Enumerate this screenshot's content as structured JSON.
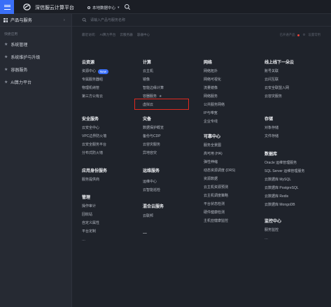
{
  "topbar": {
    "brand": "深信服云计算平台",
    "region": "本地数据中心",
    "region_caret": "▾"
  },
  "sidebar": {
    "header": "产品与服务",
    "chevron": "›",
    "sub_label": "快捷应用",
    "items": [
      {
        "label": "系统管理"
      },
      {
        "label": "系统维护与升级"
      },
      {
        "label": "容器服务"
      },
      {
        "label": "AI算力平台"
      }
    ]
  },
  "main": {
    "search_placeholder": "请输入产品与服务名称",
    "quick_links": [
      "最近访问:",
      "AI算力平台",
      "云服务器",
      "容器中心"
    ],
    "quick_right": [
      "已开通产品",
      "设置常用"
    ],
    "columns": [
      {
        "sections": [
          {
            "title": "云资源",
            "links": [
              {
                "label": "资源中心",
                "badge": "New"
              },
              {
                "label": "专属服务器组"
              },
              {
                "label": "物理机纳管"
              },
              {
                "label": "第三方公有云"
              }
            ]
          },
          {
            "title": "安全服务",
            "links": [
              {
                "label": "云安全中心"
              },
              {
                "label": "VPC边界防火墙"
              },
              {
                "label": "云安全服务平台"
              },
              {
                "label": "分布式防火墙"
              }
            ]
          },
          {
            "title": "应用身份服务",
            "links": [
              {
                "label": "服务提供商"
              }
            ]
          },
          {
            "title": "管理",
            "links": [
              {
                "label": "操作审计"
              },
              {
                "label": "回收站"
              },
              {
                "label": "自定义属性"
              },
              {
                "label": "平台定制"
              },
              {
                "label": "…"
              }
            ]
          }
        ]
      },
      {
        "sections": [
          {
            "title": "计算",
            "links": [
              {
                "label": "云主机"
              },
              {
                "label": "镜像"
              },
              {
                "label": "智能边缘计算"
              },
              {
                "label": "容器服务"
              },
              {
                "label": "虚拟云"
              }
            ]
          },
          {
            "title": "灾备",
            "links": [
              {
                "label": "数据保护概览"
              },
              {
                "label": "备份与CDP"
              },
              {
                "label": "云容灾服务"
              },
              {
                "label": "异地容灾"
              }
            ]
          },
          {
            "title": "运维服务",
            "links": [
              {
                "label": "运维中心"
              },
              {
                "label": "云智能巡检"
              }
            ]
          },
          {
            "title": "混合云服务",
            "links": [
              {
                "label": "云联邦"
              }
            ]
          },
          {
            "title": "…",
            "links": []
          }
        ]
      },
      {
        "sections": [
          {
            "title": "网络",
            "links": [
              {
                "label": "网络拓扑"
              },
              {
                "label": "网络可视化"
              },
              {
                "label": "流量镜像"
              },
              {
                "label": "网络服务"
              },
              {
                "label": "公共服务网络"
              },
              {
                "label": "IP与带宽"
              },
              {
                "label": "企业专线"
              }
            ]
          },
          {
            "title": "可靠中心",
            "links": [
              {
                "label": "服务全景图"
              },
              {
                "label": "高可用 (HA)"
              },
              {
                "label": "弹性伸缩"
              },
              {
                "label": "动态资源调度 (DRS)"
              },
              {
                "label": "资源数据"
              },
              {
                "label": "云主机资源预测"
              },
              {
                "label": "云主机调度策略"
              },
              {
                "label": "平台状态检测"
              },
              {
                "label": "硬件健康检测"
              },
              {
                "label": "主机亚健康监控"
              }
            ]
          }
        ]
      },
      {
        "sections": [
          {
            "title": "线上线下一朵云",
            "links": [
              {
                "label": "账号关联"
              },
              {
                "label": "云间互联"
              },
              {
                "label": "云安全联盟入网"
              },
              {
                "label": "云容灾服务"
              }
            ]
          },
          {
            "title": "存储",
            "links": [
              {
                "label": "对象存储"
              },
              {
                "label": "文件存储"
              }
            ]
          },
          {
            "title": "数据库",
            "links": [
              {
                "label": "Oracle 运维管理服务"
              },
              {
                "label": "SQL Server 运维管理服务"
              },
              {
                "label": "云数据库 MySQL"
              },
              {
                "label": "云数据库 PostgreSQL"
              },
              {
                "label": "云数据库 Redis"
              },
              {
                "label": "云数据库 MongoDB"
              }
            ]
          },
          {
            "title": "监控中心",
            "links": [
              {
                "label": "服务监控"
              },
              {
                "label": "…"
              }
            ]
          }
        ]
      }
    ]
  },
  "colors": {
    "accent": "#3a6ff7",
    "highlight": "#e02a1f",
    "sidebar_bg": "#262a33",
    "main_bg": "#1f232b"
  }
}
